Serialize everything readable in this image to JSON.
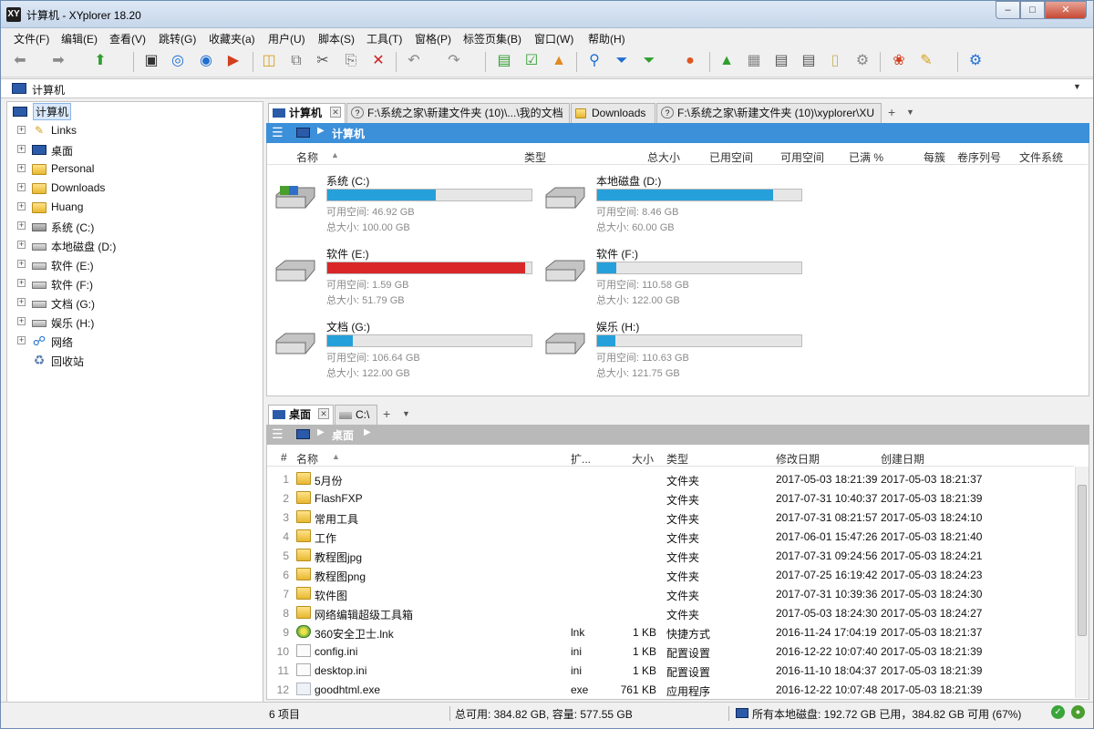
{
  "window": {
    "title": "计算机 - XYplorer 18.20",
    "app_icon": "XY"
  },
  "menu": [
    "文件(F)",
    "编辑(E)",
    "查看(V)",
    "跳转(G)",
    "收藏夹(a)",
    "用户(U)",
    "脚本(S)",
    "工具(T)",
    "窗格(P)",
    "标签页集(B)",
    "窗口(W)",
    "帮助(H)"
  ],
  "toolbar": {
    "icons": [
      "back-icon",
      "forward-icon",
      "up-icon",
      "computer-icon",
      "target-icon",
      "search-circle-icon",
      "stop-icon",
      "new-folder-icon",
      "copy-icon",
      "cut-icon",
      "paste-icon",
      "delete-icon",
      "undo-icon",
      "redo-icon",
      "copy-path-icon",
      "checkbox-icon",
      "send-icon",
      "find-icon",
      "filter-icon",
      "visual-filter-icon",
      "color-filter-icon",
      "tree-icon",
      "tiles-icon",
      "list-icon",
      "dual-pane-icon",
      "preview-icon",
      "tools-icon",
      "gift-icon",
      "brush-icon",
      "settings-icon"
    ]
  },
  "address": {
    "value": "计算机"
  },
  "tree": {
    "items": [
      {
        "label": "计算机",
        "icon": "computer-icon",
        "selected": true,
        "expander": ""
      },
      {
        "label": "Links",
        "icon": "links-folder-icon",
        "expander": "+"
      },
      {
        "label": "桌面",
        "icon": "desktop-icon",
        "expander": "+"
      },
      {
        "label": "Personal",
        "icon": "folder-icon",
        "expander": "+"
      },
      {
        "label": "Downloads",
        "icon": "download-folder-icon",
        "expander": "+"
      },
      {
        "label": "Huang",
        "icon": "user-folder-icon",
        "expander": "+"
      },
      {
        "label": "系统 (C:)",
        "icon": "system-drive-icon",
        "expander": "+"
      },
      {
        "label": "本地磁盘 (D:)",
        "icon": "drive-icon",
        "expander": "+"
      },
      {
        "label": "软件 (E:)",
        "icon": "drive-icon",
        "expander": "+"
      },
      {
        "label": "软件 (F:)",
        "icon": "drive-icon",
        "expander": "+"
      },
      {
        "label": "文档 (G:)",
        "icon": "drive-icon",
        "expander": "+"
      },
      {
        "label": "娱乐 (H:)",
        "icon": "drive-icon",
        "expander": "+"
      },
      {
        "label": "网络",
        "icon": "network-icon",
        "expander": "+"
      },
      {
        "label": "回收站",
        "icon": "recycle-bin-icon",
        "expander": ""
      }
    ]
  },
  "top_pane": {
    "tabs": [
      {
        "label": "计算机",
        "active": true
      },
      {
        "label": "F:\\系统之家\\新建文件夹 (10)\\...\\我的文档",
        "active": false
      },
      {
        "label": "Downloads",
        "active": false
      },
      {
        "label": "F:\\系统之家\\新建文件夹 (10)\\xyplorer\\XU",
        "active": false
      }
    ],
    "breadcrumb": "计算机",
    "columns": [
      "名称",
      "类型",
      "总大小",
      "已用空间",
      "可用空间",
      "已满 %",
      "每簇",
      "卷序列号",
      "文件系统"
    ],
    "drives": [
      {
        "name": "系统 (C:)",
        "free": "可用空间: 46.92 GB",
        "total": "总大小: 100.00 GB",
        "used_fraction": 0.53,
        "color": "#26a0da",
        "system": true
      },
      {
        "name": "本地磁盘 (D:)",
        "free": "可用空间: 8.46 GB",
        "total": "总大小: 60.00 GB",
        "used_fraction": 0.86,
        "color": "#26a0da",
        "system": false
      },
      {
        "name": "软件 (E:)",
        "free": "可用空间: 1.59 GB",
        "total": "总大小: 51.79 GB",
        "used_fraction": 0.97,
        "color": "#da2626",
        "system": false
      },
      {
        "name": "软件 (F:)",
        "free": "可用空间: 110.58 GB",
        "total": "总大小: 122.00 GB",
        "used_fraction": 0.094,
        "color": "#26a0da",
        "system": false
      },
      {
        "name": "文档 (G:)",
        "free": "可用空间: 106.64 GB",
        "total": "总大小: 122.00 GB",
        "used_fraction": 0.126,
        "color": "#26a0da",
        "system": false
      },
      {
        "name": "娱乐 (H:)",
        "free": "可用空间: 110.63 GB",
        "total": "总大小: 121.75 GB",
        "used_fraction": 0.091,
        "color": "#26a0da",
        "system": false
      }
    ]
  },
  "bottom_pane": {
    "tabs": [
      {
        "label": "桌面",
        "active": true
      },
      {
        "label": "C:\\",
        "active": false
      }
    ],
    "breadcrumb": "桌面",
    "columns": [
      "#",
      "名称",
      "扩...",
      "大小",
      "类型",
      "修改日期",
      "创建日期"
    ],
    "rows": [
      {
        "num": "1",
        "name": "5月份",
        "ext": "",
        "size": "",
        "type": "文件夹",
        "modified": "2017-05-03 18:21:39",
        "created": "2017-05-03 18:21:37",
        "icon": "folder"
      },
      {
        "num": "2",
        "name": "FlashFXP",
        "ext": "",
        "size": "",
        "type": "文件夹",
        "modified": "2017-07-31 10:40:37",
        "created": "2017-05-03 18:21:39",
        "icon": "folder"
      },
      {
        "num": "3",
        "name": "常用工具",
        "ext": "",
        "size": "",
        "type": "文件夹",
        "modified": "2017-07-31 08:21:57",
        "created": "2017-05-03 18:24:10",
        "icon": "folder"
      },
      {
        "num": "4",
        "name": "工作",
        "ext": "",
        "size": "",
        "type": "文件夹",
        "modified": "2017-06-01 15:47:26",
        "created": "2017-05-03 18:21:40",
        "icon": "folder"
      },
      {
        "num": "5",
        "name": "教程图jpg",
        "ext": "",
        "size": "",
        "type": "文件夹",
        "modified": "2017-07-31 09:24:56",
        "created": "2017-05-03 18:24:21",
        "icon": "folder"
      },
      {
        "num": "6",
        "name": "教程图png",
        "ext": "",
        "size": "",
        "type": "文件夹",
        "modified": "2017-07-25 16:19:42",
        "created": "2017-05-03 18:24:23",
        "icon": "folder"
      },
      {
        "num": "7",
        "name": "软件图",
        "ext": "",
        "size": "",
        "type": "文件夹",
        "modified": "2017-07-31 10:39:36",
        "created": "2017-05-03 18:24:30",
        "icon": "folder"
      },
      {
        "num": "8",
        "name": "网络编辑超级工具箱",
        "ext": "",
        "size": "",
        "type": "文件夹",
        "modified": "2017-05-03 18:24:30",
        "created": "2017-05-03 18:24:27",
        "icon": "folder"
      },
      {
        "num": "9",
        "name": "360安全卫士.lnk",
        "ext": "lnk",
        "size": "1 KB",
        "type": "快捷方式",
        "modified": "2016-11-24 17:04:19",
        "created": "2017-05-03 18:21:37",
        "icon": "lnk"
      },
      {
        "num": "10",
        "name": "config.ini",
        "ext": "ini",
        "size": "1 KB",
        "type": "配置设置",
        "modified": "2016-12-22 10:07:40",
        "created": "2017-05-03 18:21:39",
        "icon": "file"
      },
      {
        "num": "11",
        "name": "desktop.ini",
        "ext": "ini",
        "size": "1 KB",
        "type": "配置设置",
        "modified": "2016-11-10 18:04:37",
        "created": "2017-05-03 18:21:39",
        "icon": "file"
      },
      {
        "num": "12",
        "name": "goodhtml.exe",
        "ext": "exe",
        "size": "761 KB",
        "type": "应用程序",
        "modified": "2016-12-22 10:07:48",
        "created": "2017-05-03 18:21:39",
        "icon": "exe"
      }
    ]
  },
  "status": {
    "count": "6 项目",
    "total": "总可用: 384.82 GB, 容量: 577.55 GB",
    "disks": "所有本地磁盘: 192.72 GB 已用，384.82 GB 可用 (67%)"
  }
}
